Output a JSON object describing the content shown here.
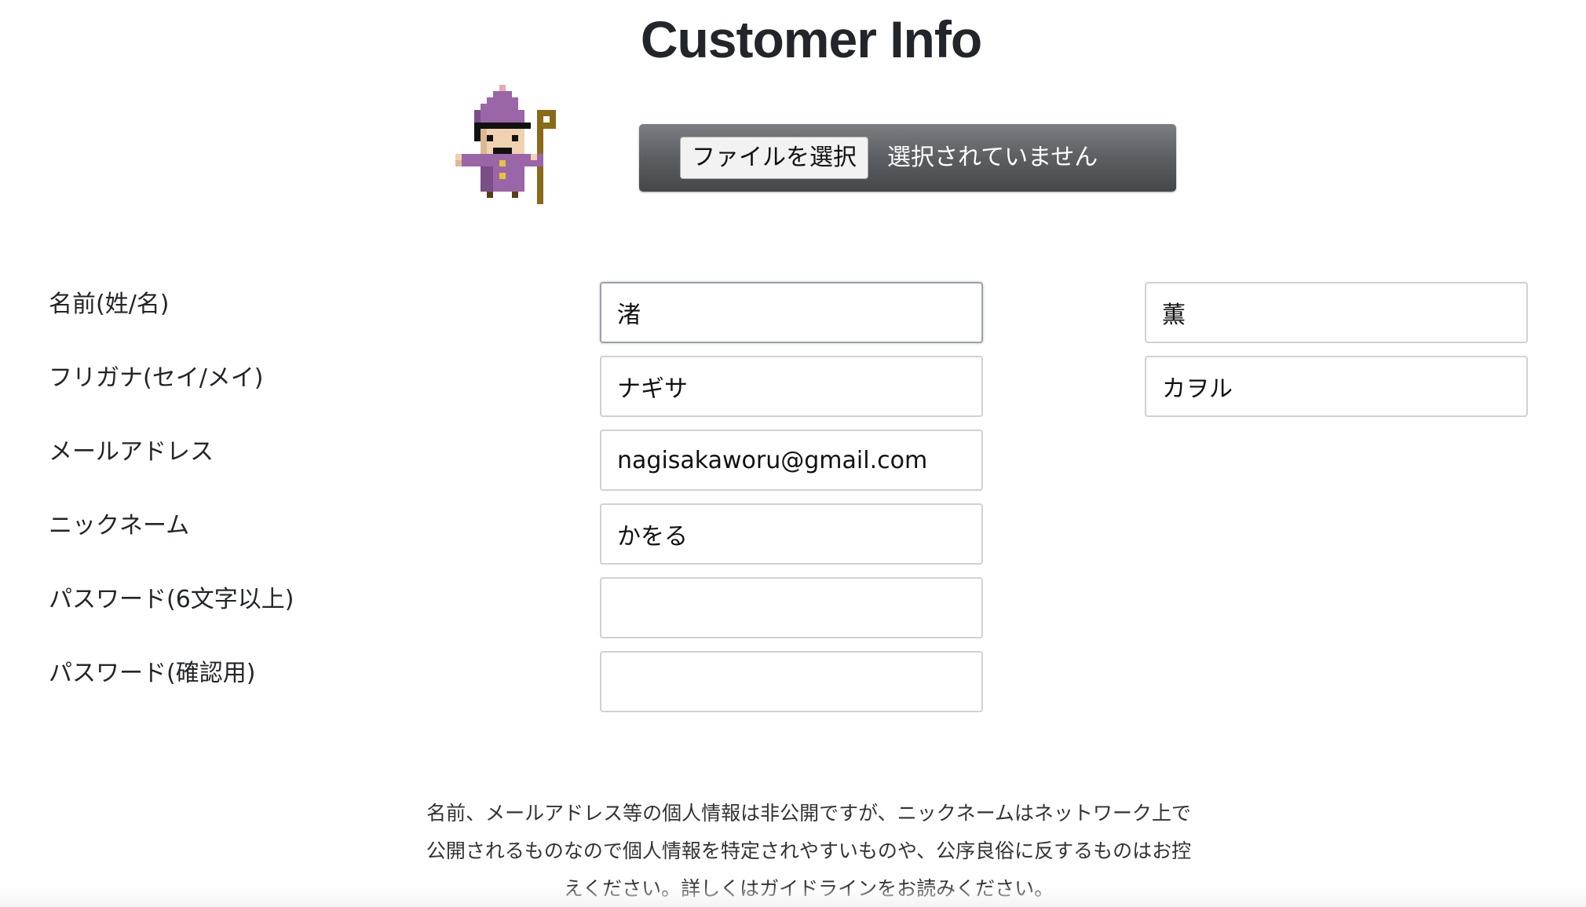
{
  "header": {
    "title": "Customer Info"
  },
  "avatar": {
    "icon": "pixel-wizard-icon"
  },
  "file_picker": {
    "button_label": "ファイルを選択",
    "status": "選択されていません"
  },
  "form": {
    "name": {
      "label": "名前(姓/名)",
      "last_value": "渚",
      "first_value": "薫"
    },
    "furigana": {
      "label": "フリガナ(セイ/メイ)",
      "last_value": "ナギサ",
      "first_value": "カヲル"
    },
    "email": {
      "label": "メールアドレス",
      "value": "nagisakaworu@gmail.com"
    },
    "nickname": {
      "label": "ニックネーム",
      "value": "かをる"
    },
    "password": {
      "label": "パスワード(6文字以上)",
      "value": ""
    },
    "password_confirm": {
      "label": "パスワード(確認用)",
      "value": ""
    }
  },
  "notice": {
    "line1": "名前、メールアドレス等の個人情報は非公開ですが、ニックネームはネットワーク上で",
    "line2": "公開されるものなので個人情報を特定されやすいものや、公序良俗に反するものはお控",
    "line3": "えください。詳しくはガイドラインをお読みください。"
  },
  "colors": {
    "title": "#222529",
    "file_picker_bg": "#5b5e62",
    "input_border": "#cfd2d4"
  }
}
